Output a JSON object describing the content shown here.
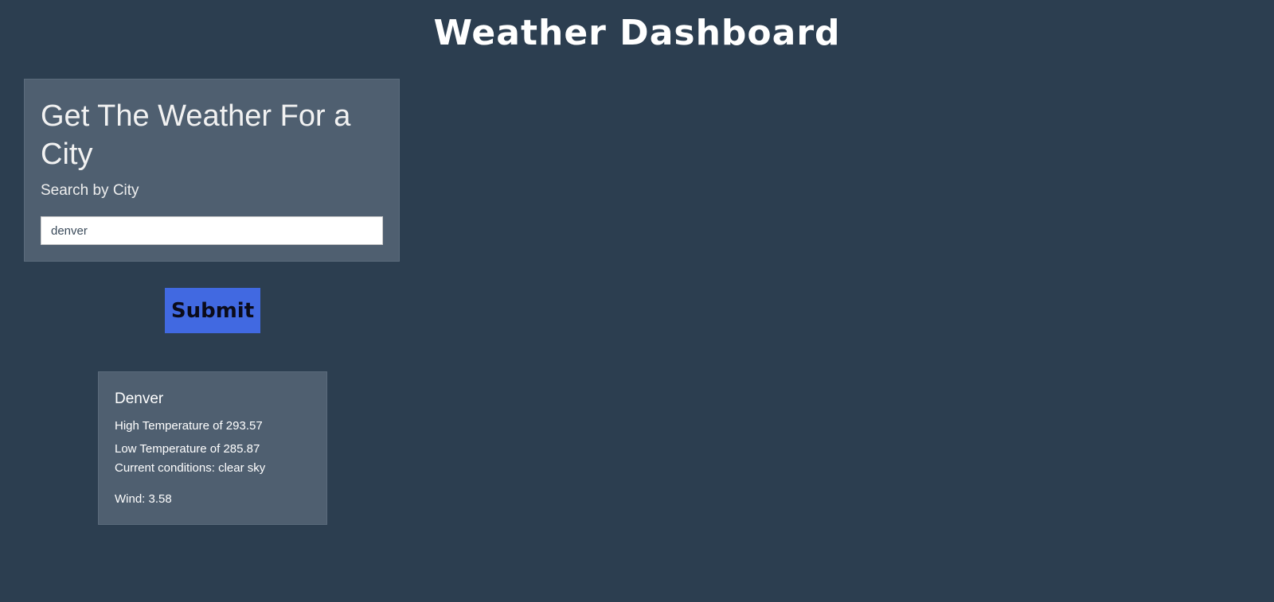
{
  "header": {
    "title": "Weather Dashboard"
  },
  "search": {
    "heading": "Get The Weather For a City",
    "subheading": "Search by City",
    "input_value": "denver",
    "submit_label": "Submit"
  },
  "result": {
    "city": "Denver",
    "high": "High Temperature of 293.57",
    "low": "Low Temperature of 285.87",
    "conditions": "Current conditions: clear sky",
    "wind": "Wind: 3.58"
  },
  "colors": {
    "background": "#2c3e50",
    "card": "#4f5f70",
    "accent": "#4169e1"
  }
}
